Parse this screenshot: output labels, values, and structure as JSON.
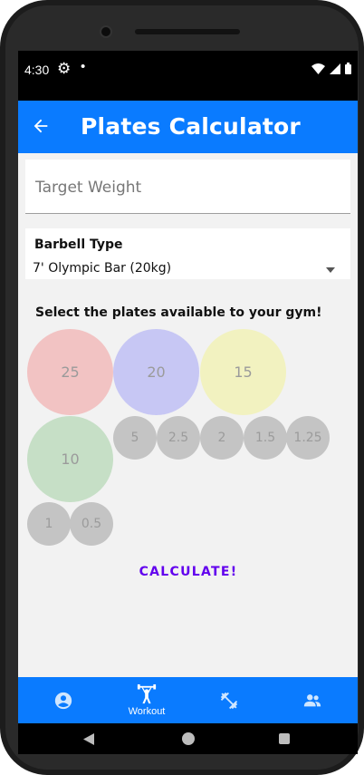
{
  "status_bar": {
    "time": "4:30",
    "gear_icon": "settings-gear-icon",
    "dot": "•"
  },
  "app_bar": {
    "title": "Plates Calculator",
    "back_icon": "back-arrow-icon"
  },
  "target_weight": {
    "placeholder": "Target Weight",
    "value": ""
  },
  "barbell": {
    "label": "Barbell Type",
    "selected": "7' Olympic Bar (20kg)"
  },
  "plates_heading": "Select the plates available to your gym!",
  "plates": [
    {
      "label": "25",
      "color": "#f2c3c3"
    },
    {
      "label": "20",
      "color": "#c7c7f4"
    },
    {
      "label": "15",
      "color": "#f2f2c0"
    },
    {
      "label": "10",
      "color": "#c6dfc6"
    },
    {
      "label": "5",
      "color": "#c4c4c4"
    },
    {
      "label": "2.5",
      "color": "#c4c4c4"
    },
    {
      "label": "2",
      "color": "#c4c4c4"
    },
    {
      "label": "1.5",
      "color": "#c4c4c4"
    },
    {
      "label": "1.25",
      "color": "#c4c4c4"
    },
    {
      "label": "1",
      "color": "#c4c4c4"
    },
    {
      "label": "0.5",
      "color": "#c4c4c4"
    }
  ],
  "calculate_label": "CALCULATE!",
  "bottom_nav": {
    "items": [
      {
        "icon": "account-circle-icon",
        "label": ""
      },
      {
        "icon": "weightlifter-icon",
        "label": "Workout"
      },
      {
        "icon": "dumbbell-icon",
        "label": ""
      },
      {
        "icon": "people-icon",
        "label": ""
      }
    ]
  },
  "colors": {
    "primary": "#0a7bff",
    "accent": "#6200ee",
    "background": "#f2f2f2"
  }
}
